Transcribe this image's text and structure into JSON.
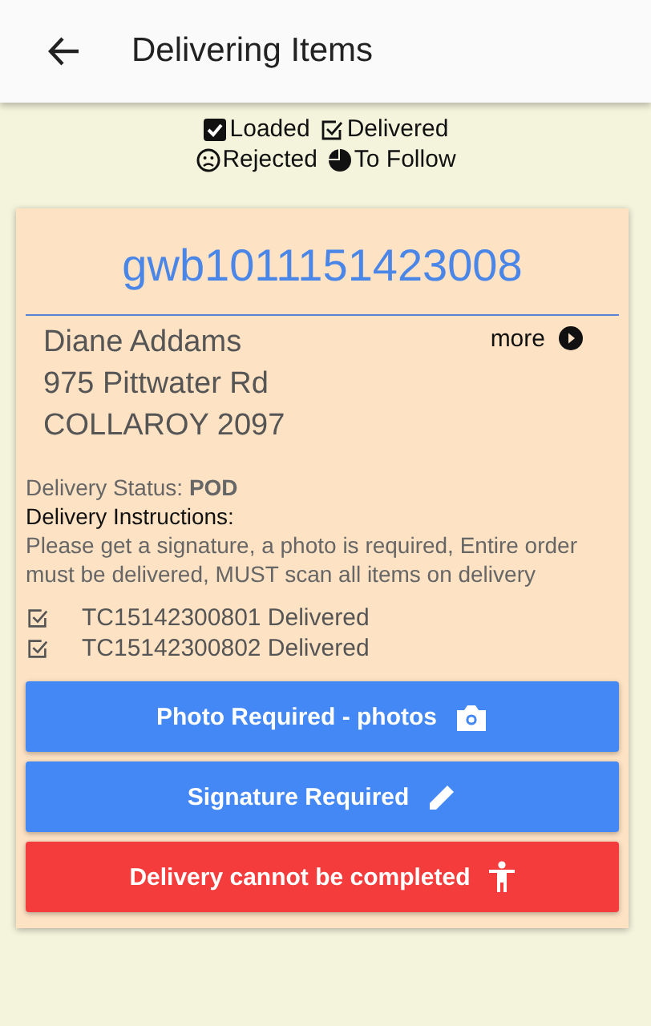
{
  "header": {
    "title": "Delivering Items"
  },
  "legend": [
    {
      "kind": "loaded",
      "label": "Loaded"
    },
    {
      "kind": "delivered",
      "label": "Delivered"
    },
    {
      "kind": "rejected",
      "label": "Rejected"
    },
    {
      "kind": "to_follow",
      "label": "To Follow"
    }
  ],
  "card": {
    "consignment": "gwb1011151423008",
    "name": "Diane Addams",
    "address_line_1": "975 Pittwater Rd",
    "address_line_2": "COLLAROY 2097",
    "more": "more",
    "status_label": "Delivery Status:",
    "status_value": "POD",
    "instructions_label": "Delivery Instructions:",
    "instructions": "Please get a signature, a photo is required, Entire order must be delivered, MUST scan all items on delivery",
    "items": [
      {
        "kind": "delivered",
        "label": "TC15142300801 Delivered"
      },
      {
        "kind": "delivered",
        "label": "TC15142300802 Delivered"
      }
    ],
    "buttons": [
      {
        "kind": "photo",
        "label": "Photo Required - photos"
      },
      {
        "kind": "signature",
        "label": "Signature Required"
      },
      {
        "kind": "cannot_complete",
        "label": "Delivery cannot be completed"
      }
    ]
  }
}
